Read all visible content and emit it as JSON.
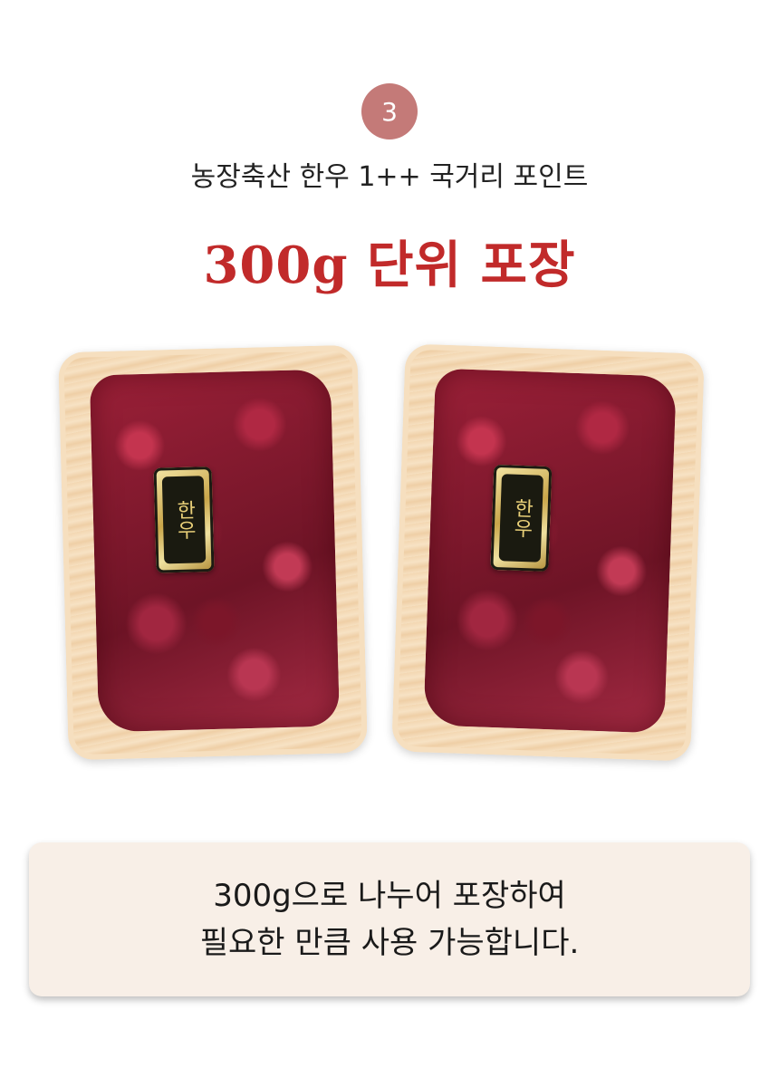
{
  "step": {
    "number": "3"
  },
  "subtitle": "농장축산 한우 1++ 국거리 포인트",
  "headline": "300g 단위 포장",
  "product_images": [
    {
      "sticker_text": "한우"
    },
    {
      "sticker_text": "한우"
    }
  ],
  "info": {
    "line1": "300g으로 나누어 포장하여",
    "line2": "필요한 만큼 사용 가능합니다."
  },
  "colors": {
    "accent": "#c12a2a",
    "badge": "#c47a78",
    "info_bg": "#f8efe7"
  }
}
